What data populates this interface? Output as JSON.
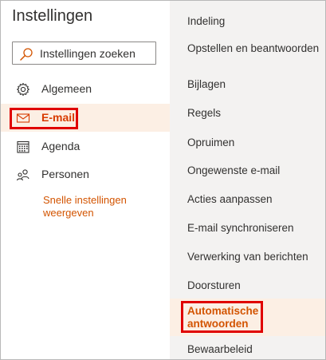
{
  "settings": {
    "title": "Instellingen",
    "search": {
      "placeholder": "Instellingen zoeken"
    },
    "nav": [
      {
        "label": "Algemeen",
        "icon": "gear-icon",
        "active": false
      },
      {
        "label": "E-mail",
        "icon": "mail-icon",
        "active": true
      },
      {
        "label": "Agenda",
        "icon": "calendar-icon",
        "active": false
      },
      {
        "label": "Personen",
        "icon": "people-icon",
        "active": false
      }
    ],
    "quick_settings_link": "Snelle instellingen weergeven"
  },
  "mail_settings": {
    "items": [
      {
        "label": "Indeling",
        "active": false
      },
      {
        "label": "Opstellen en beantwoorden",
        "active": false
      },
      {
        "label": "Bijlagen",
        "active": false
      },
      {
        "label": "Regels",
        "active": false
      },
      {
        "label": "Opruimen",
        "active": false
      },
      {
        "label": "Ongewenste e-mail",
        "active": false
      },
      {
        "label": "Acties aanpassen",
        "active": false
      },
      {
        "label": "E-mail synchroniseren",
        "active": false
      },
      {
        "label": "Verwerking van berichten",
        "active": false
      },
      {
        "label": "Doorsturen",
        "active": false
      },
      {
        "label": "Automatische antwoorden",
        "active": true
      },
      {
        "label": "Bewaarbeleid",
        "active": false
      }
    ]
  },
  "colors": {
    "accent": "#d83b01",
    "active_background": "#fcefe4",
    "highlight_box": "#e00000",
    "right_pane_background": "#f3f2f1"
  }
}
